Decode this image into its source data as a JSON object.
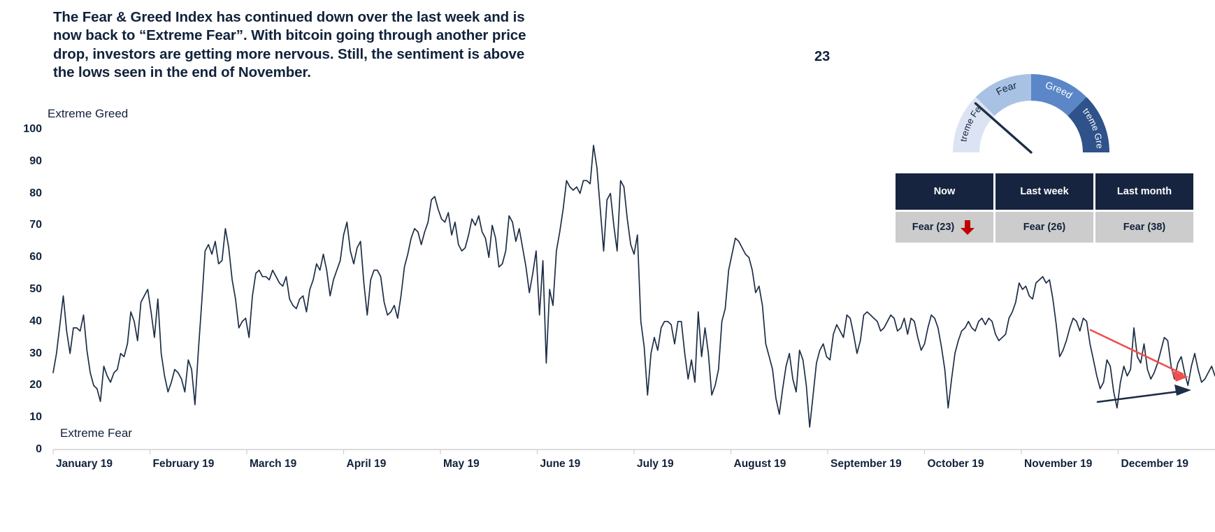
{
  "commentary": {
    "text": "The Fear & Greed Index has continued down over the last week and is now back to “Extreme Fear”. With bitcoin going through another price drop, investors are getting more nervous. Still, the sentiment is above the lows seen in the end of November."
  },
  "gauge": {
    "value_label": "23",
    "segments": [
      {
        "label": "Extreme Fear",
        "color": "#dce3f2",
        "text_color": "#11223b",
        "from": 0,
        "to": 25
      },
      {
        "label": "Fear",
        "color": "#a8c2e3",
        "text_color": "#11223b",
        "from": 25,
        "to": 50
      },
      {
        "label": "Greed",
        "color": "#5b87c8",
        "text_color": "#ffffff",
        "from": 50,
        "to": 75
      },
      {
        "label": "Extreme Greed",
        "color": "#2e5289",
        "text_color": "#ffffff",
        "from": 75,
        "to": 100
      }
    ],
    "needle_value": 23,
    "needle_color": "#1d2e46"
  },
  "summary": {
    "columns": [
      "Now",
      "Last week",
      "Last month"
    ],
    "values": [
      "Fear (23)",
      "Fear (26)",
      "Fear (38)"
    ],
    "trend_icon": "down-arrow-icon",
    "trend_color": "#c00000",
    "trend_on_column": 0
  },
  "chart_data": {
    "type": "line",
    "title": "",
    "xlabel": "",
    "ylabel": "",
    "ylim": [
      0,
      100
    ],
    "yticks": [
      0,
      10,
      20,
      30,
      40,
      50,
      60,
      70,
      80,
      90,
      100
    ],
    "axis_top_label": "Extreme Greed",
    "axis_bottom_label": "Extreme Fear",
    "grid": false,
    "legend": "none",
    "line_color": "#1d2e46",
    "categories": [
      "January 19",
      "February 19",
      "March 19",
      "April 19",
      "May 19",
      "June 19",
      "July 19",
      "August 19",
      "September 19",
      "October 19",
      "November 19",
      "December 19"
    ],
    "series": [
      {
        "name": "Fear & Greed Index",
        "values": [
          24,
          30,
          39,
          48,
          37,
          30,
          38,
          38,
          37,
          42,
          31,
          24,
          20,
          19,
          15,
          26,
          23,
          21,
          24,
          25,
          30,
          29,
          33,
          43,
          40,
          34,
          46,
          48,
          50,
          43,
          35,
          47,
          30,
          23,
          18,
          21,
          25,
          24,
          22,
          18,
          28,
          25,
          14,
          31,
          46,
          62,
          64,
          61,
          65,
          58,
          59,
          69,
          63,
          53,
          47,
          38,
          40,
          41,
          35,
          48,
          55,
          56,
          54,
          54,
          53,
          56,
          54,
          52,
          51,
          54,
          47,
          45,
          44,
          47,
          48,
          43,
          50,
          53,
          58,
          56,
          61,
          56,
          48,
          53,
          56,
          59,
          67,
          71,
          62,
          58,
          63,
          65,
          52,
          42,
          53,
          56,
          56,
          54,
          46,
          42,
          43,
          45,
          41,
          48,
          57,
          61,
          66,
          69,
          68,
          64,
          68,
          71,
          78,
          79,
          75,
          72,
          71,
          74,
          67,
          71,
          64,
          62,
          63,
          67,
          72,
          70,
          73,
          68,
          66,
          60,
          70,
          66,
          57,
          58,
          62,
          73,
          71,
          65,
          69,
          63,
          57,
          49,
          55,
          62,
          42,
          59,
          27,
          50,
          45,
          62,
          68,
          75,
          84,
          82,
          81,
          82,
          80,
          84,
          84,
          83,
          95,
          88,
          75,
          62,
          78,
          80,
          70,
          62,
          84,
          82,
          72,
          64,
          61,
          67,
          40,
          32,
          17,
          30,
          35,
          31,
          38,
          40,
          40,
          39,
          33,
          40,
          40,
          30,
          22,
          28,
          21,
          43,
          29,
          38,
          30,
          17,
          20,
          25,
          40,
          44,
          56,
          61,
          66,
          65,
          63,
          61,
          60,
          56,
          49,
          51,
          45,
          33,
          29,
          25,
          16,
          11,
          19,
          26,
          30,
          22,
          18,
          31,
          28,
          20,
          7,
          17,
          27,
          31,
          33,
          29,
          28,
          36,
          39,
          37,
          35,
          42,
          41,
          36,
          30,
          34,
          42,
          43,
          42,
          41,
          40,
          37,
          38,
          40,
          42,
          41,
          37,
          38,
          41,
          36,
          41,
          40,
          35,
          31,
          33,
          38,
          42,
          41,
          38,
          32,
          25,
          13,
          22,
          30,
          34,
          37,
          38,
          40,
          38,
          37,
          40,
          41,
          39,
          41,
          40,
          36,
          34,
          35,
          36,
          41,
          43,
          46,
          52,
          50,
          51,
          48,
          47,
          52,
          53,
          54,
          52,
          53,
          47,
          39,
          29,
          31,
          34,
          38,
          41,
          40,
          37,
          41,
          40,
          33,
          28,
          23,
          19,
          21,
          28,
          26,
          18,
          13,
          21,
          26,
          23,
          25,
          38,
          29,
          27,
          33,
          25,
          22,
          24,
          27,
          31,
          35,
          34,
          26,
          22,
          27,
          29,
          24,
          20,
          26,
          30,
          25,
          21,
          22,
          24,
          26,
          23
        ]
      }
    ],
    "annotations": [
      {
        "name": "resistance-trendline",
        "label": "",
        "color": "#ee4f4f",
        "direction": "down"
      },
      {
        "name": "support-trendline",
        "label": "",
        "color": "#1d2e46",
        "direction": "up"
      }
    ]
  }
}
